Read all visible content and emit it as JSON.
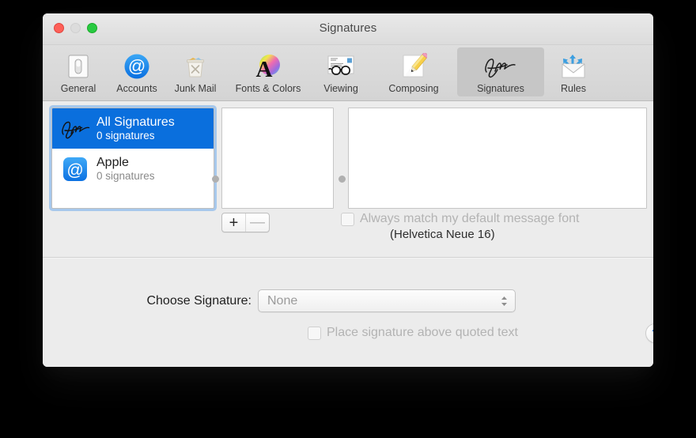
{
  "window": {
    "title": "Signatures",
    "controls": {
      "close": "close-button",
      "minimize": "minimize-button",
      "zoom": "zoom-button"
    }
  },
  "toolbar": {
    "items": [
      {
        "label": "General",
        "icon": "general-icon",
        "selected": false
      },
      {
        "label": "Accounts",
        "icon": "accounts-icon",
        "selected": false
      },
      {
        "label": "Junk Mail",
        "icon": "junk-mail-icon",
        "selected": false
      },
      {
        "label": "Fonts & Colors",
        "icon": "fonts-colors-icon",
        "selected": false
      },
      {
        "label": "Viewing",
        "icon": "viewing-icon",
        "selected": false
      },
      {
        "label": "Composing",
        "icon": "composing-icon",
        "selected": false
      },
      {
        "label": "Signatures",
        "icon": "signatures-icon",
        "selected": true
      },
      {
        "label": "Rules",
        "icon": "rules-icon",
        "selected": false
      }
    ]
  },
  "accounts_list": {
    "rows": [
      {
        "name": "All Signatures",
        "count": "0 signatures",
        "icon": "signature-scribble-icon",
        "selected": true
      },
      {
        "name": "Apple",
        "count": "0 signatures",
        "icon": "at-sign-icon",
        "selected": false
      }
    ]
  },
  "signature_controls": {
    "add_label": "+",
    "remove_label": "—"
  },
  "match_font": {
    "checkbox_label": "Always match my default message font",
    "font_note": "(Helvetica Neue 16)",
    "checked": false
  },
  "choose_signature": {
    "label": "Choose Signature:",
    "value": "None",
    "options": [
      "None"
    ]
  },
  "place_signature": {
    "label": "Place signature above quoted text",
    "checked": false
  },
  "help": {
    "label": "?"
  },
  "colors": {
    "selection_blue": "#0a6fdd",
    "focus_ring": "#7db1eb",
    "accent_blue": "#2f7bd8",
    "window_bg": "#ececec",
    "toolbar_bg": "#d8d8d8"
  }
}
